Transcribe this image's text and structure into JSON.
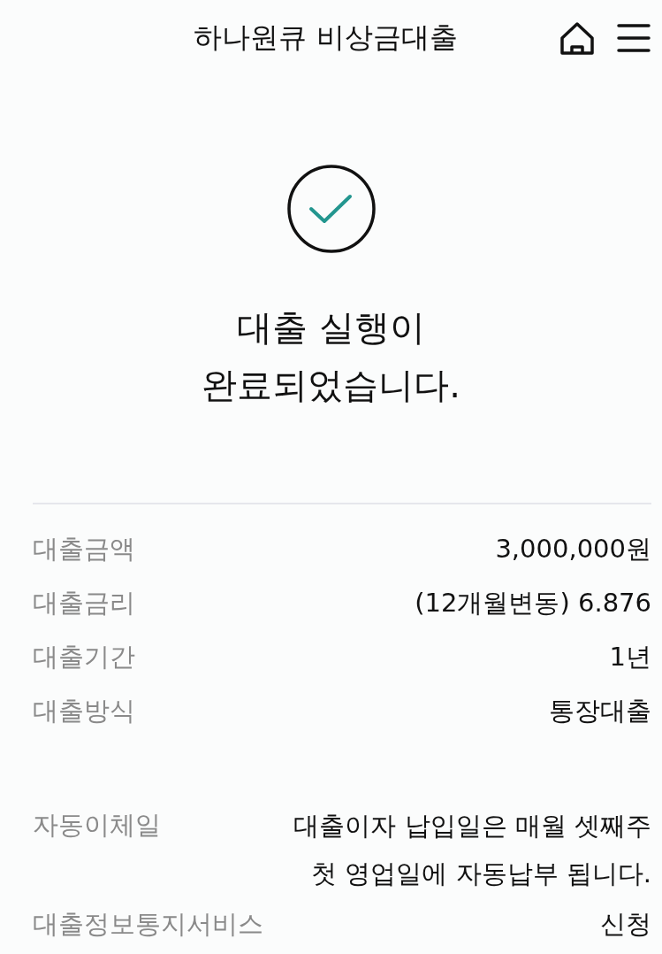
{
  "header": {
    "title": "하나원큐 비상금대출"
  },
  "result": {
    "lines": [
      "대출 실행이",
      "완료되었습니다."
    ]
  },
  "details": [
    {
      "label": "대출금액",
      "value": "3,000,000원"
    },
    {
      "label": "대출금리",
      "value": "(12개월변동) 6.876"
    },
    {
      "label": "대출기간",
      "value": "1년"
    },
    {
      "label": "대출방식",
      "value": "통장대출"
    }
  ],
  "details_2": [
    {
      "label": "자동이체일",
      "value_lines": [
        "대출이자 납입일은 매월 셋째주",
        "첫 영업일에 자동납부 됩니다."
      ]
    },
    {
      "label": "대출정보통지서비스",
      "value_lines": [
        "신청"
      ]
    }
  ]
}
